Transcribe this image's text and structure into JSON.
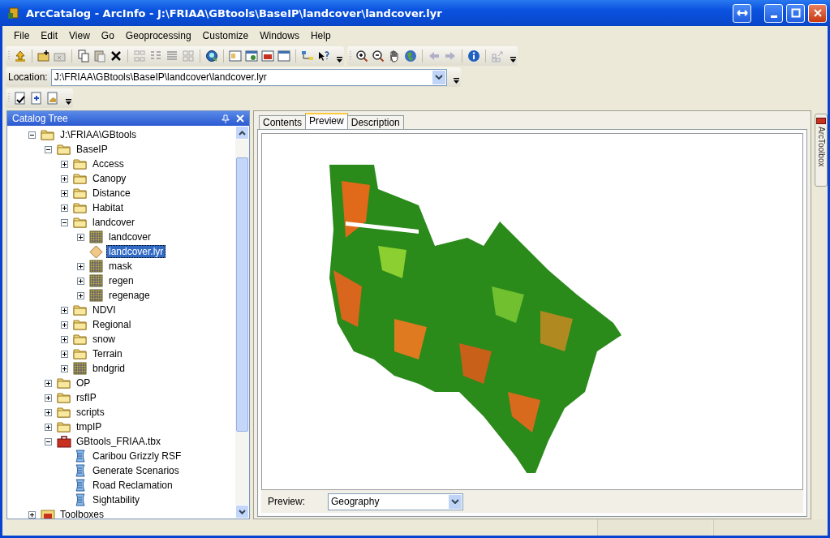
{
  "window": {
    "title": "ArcCatalog - ArcInfo - J:\\FRIAA\\GBtools\\BaseIP\\landcover\\landcover.lyr"
  },
  "menu": [
    "File",
    "Edit",
    "View",
    "Go",
    "Geoprocessing",
    "Customize",
    "Windows",
    "Help"
  ],
  "location": {
    "label": "Location:",
    "value": "J:\\FRIAA\\GBtools\\BaseIP\\landcover\\landcover.lyr"
  },
  "catalog_tree": {
    "title": "Catalog Tree",
    "items": [
      {
        "label": "J:\\FRIAA\\GBtools",
        "kind": "folder",
        "expanded": true,
        "selected": false,
        "children": [
          {
            "label": "BaseIP",
            "kind": "folder",
            "expanded": true,
            "selected": false,
            "children": [
              {
                "label": "Access",
                "kind": "folder",
                "expanded": false,
                "selected": false
              },
              {
                "label": "Canopy",
                "kind": "folder",
                "expanded": false,
                "selected": false
              },
              {
                "label": "Distance",
                "kind": "folder",
                "expanded": false,
                "selected": false
              },
              {
                "label": "Habitat",
                "kind": "folder",
                "expanded": false,
                "selected": false
              },
              {
                "label": "landcover",
                "kind": "folder",
                "expanded": true,
                "selected": false,
                "children": [
                  {
                    "label": "landcover",
                    "kind": "raster",
                    "expanded": false,
                    "selected": false
                  },
                  {
                    "label": "landcover.lyr",
                    "kind": "layer",
                    "selected": true
                  },
                  {
                    "label": "mask",
                    "kind": "raster",
                    "expanded": false,
                    "selected": false
                  },
                  {
                    "label": "regen",
                    "kind": "raster",
                    "expanded": false,
                    "selected": false
                  },
                  {
                    "label": "regenage",
                    "kind": "raster",
                    "expanded": false,
                    "selected": false
                  }
                ]
              },
              {
                "label": "NDVI",
                "kind": "folder",
                "expanded": false,
                "selected": false
              },
              {
                "label": "Regional",
                "kind": "folder",
                "expanded": false,
                "selected": false
              },
              {
                "label": "snow",
                "kind": "folder",
                "expanded": false,
                "selected": false
              },
              {
                "label": "Terrain",
                "kind": "folder",
                "expanded": false,
                "selected": false
              },
              {
                "label": "bndgrid",
                "kind": "raster",
                "expanded": false,
                "selected": false
              }
            ]
          },
          {
            "label": "OP",
            "kind": "folder",
            "expanded": false,
            "selected": false
          },
          {
            "label": "rsfIP",
            "kind": "folder",
            "expanded": false,
            "selected": false
          },
          {
            "label": "scripts",
            "kind": "folder",
            "expanded": false,
            "selected": false
          },
          {
            "label": "tmpIP",
            "kind": "folder",
            "expanded": false,
            "selected": false
          },
          {
            "label": "GBtools_FRIAA.tbx",
            "kind": "toolbox",
            "expanded": true,
            "selected": false,
            "children": [
              {
                "label": "Caribou Grizzly RSF",
                "kind": "script",
                "selected": false
              },
              {
                "label": "Generate Scenarios",
                "kind": "script",
                "selected": false
              },
              {
                "label": "Road Reclamation",
                "kind": "script",
                "selected": false
              },
              {
                "label": "Sightability",
                "kind": "script",
                "selected": false
              }
            ]
          }
        ]
      },
      {
        "label": "Toolboxes",
        "kind": "toolboxes",
        "expanded": false,
        "selected": false
      }
    ]
  },
  "tabs": [
    {
      "label": "Contents",
      "selected": false
    },
    {
      "label": "Preview",
      "selected": true
    },
    {
      "label": "Description",
      "selected": false
    }
  ],
  "preview": {
    "label": "Preview:",
    "value": "Geography"
  },
  "side_tab": {
    "label": "ArcToolbox"
  }
}
